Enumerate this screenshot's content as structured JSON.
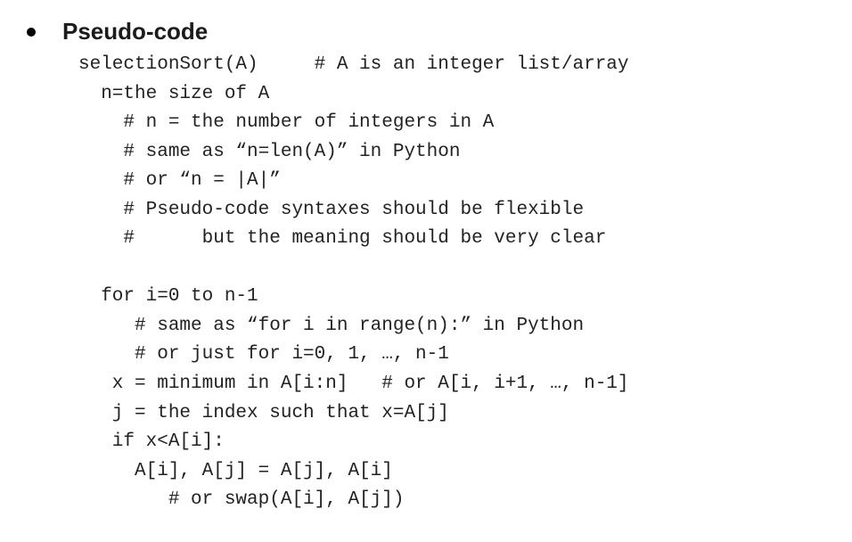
{
  "header": {
    "title": "Pseudo-code"
  },
  "code": {
    "line1": "selectionSort(A)     # A is an integer list/array",
    "line2": "  n=the size of A",
    "line3": "    # n = the number of integers in A",
    "line4": "    # same as “n=len(A)” in Python",
    "line5": "    # or “n = |A|”",
    "line6": "    # Pseudo-code syntaxes should be flexible",
    "line7": "    #      but the meaning should be very clear",
    "line8": "",
    "line9": "  for i=0 to n-1",
    "line10": "     # same as “for i in range(n):” in Python",
    "line11": "     # or just for i=0, 1, …, n-1",
    "line12": "   x = minimum in A[i:n]   # or A[i, i+1, …, n-1]",
    "line13": "   j = the index such that x=A[j]",
    "line14": "   if x<A[i]:",
    "line15": "     A[i], A[j] = A[j], A[i]",
    "line16": "        # or swap(A[i], A[j])"
  }
}
